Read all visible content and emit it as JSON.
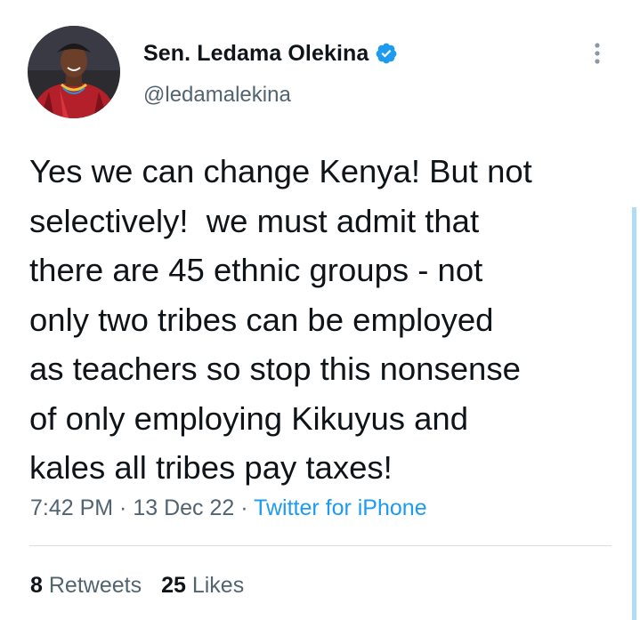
{
  "author": {
    "display_name": "Sen. Ledama Olekina",
    "handle": "@ledamalekina",
    "verified": true,
    "avatar_icon": "profile-photo"
  },
  "tweet": {
    "text": "Yes we can change Kenya! But not\nselectively!  we must admit that\nthere are 45 ethnic groups - not\nonly two tribes can be employed\nas teachers so stop this nonsense\nof only employing Kikuyus and\nkales all tribes pay taxes!",
    "time": "7:42 PM",
    "date": "13 Dec 22",
    "separator": " · ",
    "source": "Twitter for iPhone"
  },
  "stats": {
    "retweets_count": "8",
    "retweets_label": "Retweets",
    "likes_count": "25",
    "likes_label": "Likes"
  },
  "icons": {
    "more": "more-vertical-icon",
    "verified": "verified-badge-icon"
  },
  "colors": {
    "accent": "#1d9bf0",
    "text": "#0f1419",
    "secondary": "#536471"
  }
}
